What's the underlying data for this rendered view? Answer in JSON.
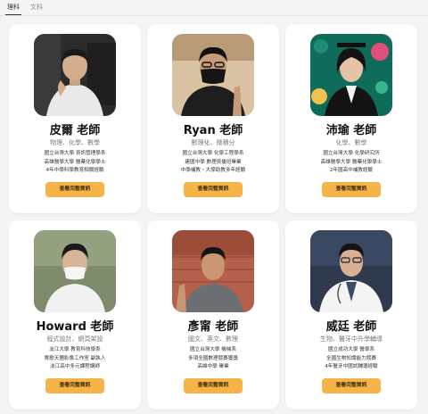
{
  "tabs": [
    {
      "label": "理科",
      "active": true
    },
    {
      "label": "文科",
      "active": false
    }
  ],
  "colors": {
    "accent": "#f6b347",
    "background": "#f4f4f4",
    "card": "#ffffff"
  },
  "teachers": [
    {
      "name": "皮爾 老師",
      "subjects": "物理、化學、數學",
      "bio": [
        "國立台灣大學 資訊管理學系",
        "高雄醫學大學 醫藥化學學士",
        "4年中學科學教育相關經驗"
      ],
      "button": "查看完整資訊",
      "photo": "teacher-photo"
    },
    {
      "name": "Ryan 老師",
      "subjects": "數理化、微積分",
      "bio": [
        "國立台灣大學 化學工程學系",
        "建國中學 數理資優班畢業",
        "中學補教・大學助教多年經驗"
      ],
      "button": "查看完整資訊",
      "photo": "teacher-photo"
    },
    {
      "name": "沛瑜 老師",
      "subjects": "化學、數學",
      "bio": [
        "國立台灣大學 化學研究所",
        "高雄醫學大學 醫藥化學學士",
        "2年國高中補教經驗"
      ],
      "button": "查看完整資訊",
      "photo": "teacher-photo"
    },
    {
      "name": "Howard 老師",
      "subjects": "程式設計、網頁架設",
      "bio": [
        "淡江大學 教育科技學系",
        "賣歌天團影像工作室 副執人",
        "淡江高中多元課程講師"
      ],
      "button": "查看完整資訊",
      "photo": "teacher-photo"
    },
    {
      "name": "彥甯 老師",
      "subjects": "國文、英文、數理",
      "bio": [
        "國立台灣大學 機械系",
        "多項全國數理競賽獲獎",
        "高雄中學 畢業"
      ],
      "button": "查看完整資訊",
      "photo": "teacher-photo"
    },
    {
      "name": "威廷 老師",
      "subjects": "生物、醫牙中升學輔導",
      "bio": [
        "國立成功大學 醫學系",
        "全國生物知識能力競賽",
        "4年醫牙中國試輔導經驗"
      ],
      "button": "查看完整資訊",
      "photo": "teacher-photo"
    }
  ]
}
